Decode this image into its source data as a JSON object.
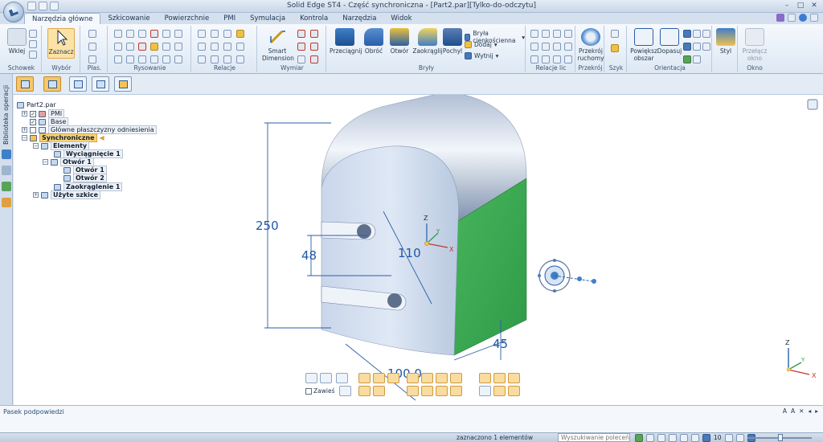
{
  "window": {
    "title": "Solid Edge ST4 - Część synchroniczna - [Part2.par][Tylko-do-odczytu]"
  },
  "tabs": [
    {
      "label": "Narzędzia główne",
      "active": true
    },
    {
      "label": "Szkicowanie"
    },
    {
      "label": "Powierzchnie"
    },
    {
      "label": "PMI"
    },
    {
      "label": "Symulacja"
    },
    {
      "label": "Kontrola"
    },
    {
      "label": "Narzędzia"
    },
    {
      "label": "Widok"
    }
  ],
  "ribbon": {
    "groups": {
      "schowek": "Schowek",
      "wybor": "Wybór",
      "plas": "Płas.",
      "rysowanie": "Rysowanie",
      "relacje": "Relacje",
      "wymiar": "Wymiar",
      "bryly": "Bryły",
      "relacje_lic": "Relacje lic",
      "przekroj": "Przekrój",
      "szyk": "Szyk",
      "orientacja": "Orientacja",
      "okno": "Okno"
    },
    "buttons": {
      "wklej": "Wklej",
      "zaznacz": "Zaznacz",
      "smart_dimension_1": "Smart",
      "smart_dimension_2": "Dimension",
      "przeciagnij": "Przeciągnij",
      "obroc": "Obróć",
      "otwor": "Otwór",
      "zaokraglij": "Zaokrąglij",
      "pochyl": "Pochyl",
      "bryla_cienkoscienna": "Bryła cienkościenna",
      "dodaj": "Dodaj",
      "wytnij": "Wytnij",
      "przekroj_ruchomy_1": "Przekrój",
      "przekroj_ruchomy_2": "ruchomy",
      "powieksz_obszar_1": "Powiększ",
      "powieksz_obszar_2": "obszar",
      "dopasuj": "Dopasuj",
      "styl": "Styl",
      "przelacz_okno_1": "Przełącz",
      "przelacz_okno_2": "okno"
    }
  },
  "sidebar": {
    "vertical_label": "Biblioteka operacji"
  },
  "tree": {
    "root": "Part2.par",
    "pmi": "PMI",
    "base": "Base",
    "planes": "Główne płaszczyzny odniesienia",
    "synchroniczne": "Synchroniczne",
    "elementy": "Elementy",
    "wyciagniecie": "Wyciągnięcie 1",
    "otwor_group": "Otwór 1",
    "otwor1": "Otwór 1",
    "otwor2": "Otwór 2",
    "zaokraglenie": "Zaokrąglenie 1",
    "uzyte_szkice": "Użyte szkice"
  },
  "dimensions": {
    "height": "250",
    "hole_spacing": "48",
    "hole_distance": "110",
    "thickness": "45",
    "width": "100,0"
  },
  "axes": {
    "x": "X",
    "y": "Y",
    "z": "Z"
  },
  "command_bar": {
    "zawies": "Zawieś"
  },
  "prompt": {
    "title": "Pasek podpowiedzi",
    "tools": [
      "A",
      "A",
      "✕",
      "◂",
      "▸"
    ]
  },
  "status": {
    "selection": "zaznaczono 1 elementów",
    "search_placeholder": "Wyszukiwanie poleceń",
    "zoom_value": "10"
  },
  "colors": {
    "accent": "#2a5ea8",
    "face_green": "#3faa55",
    "selected": "#f7d27a"
  }
}
